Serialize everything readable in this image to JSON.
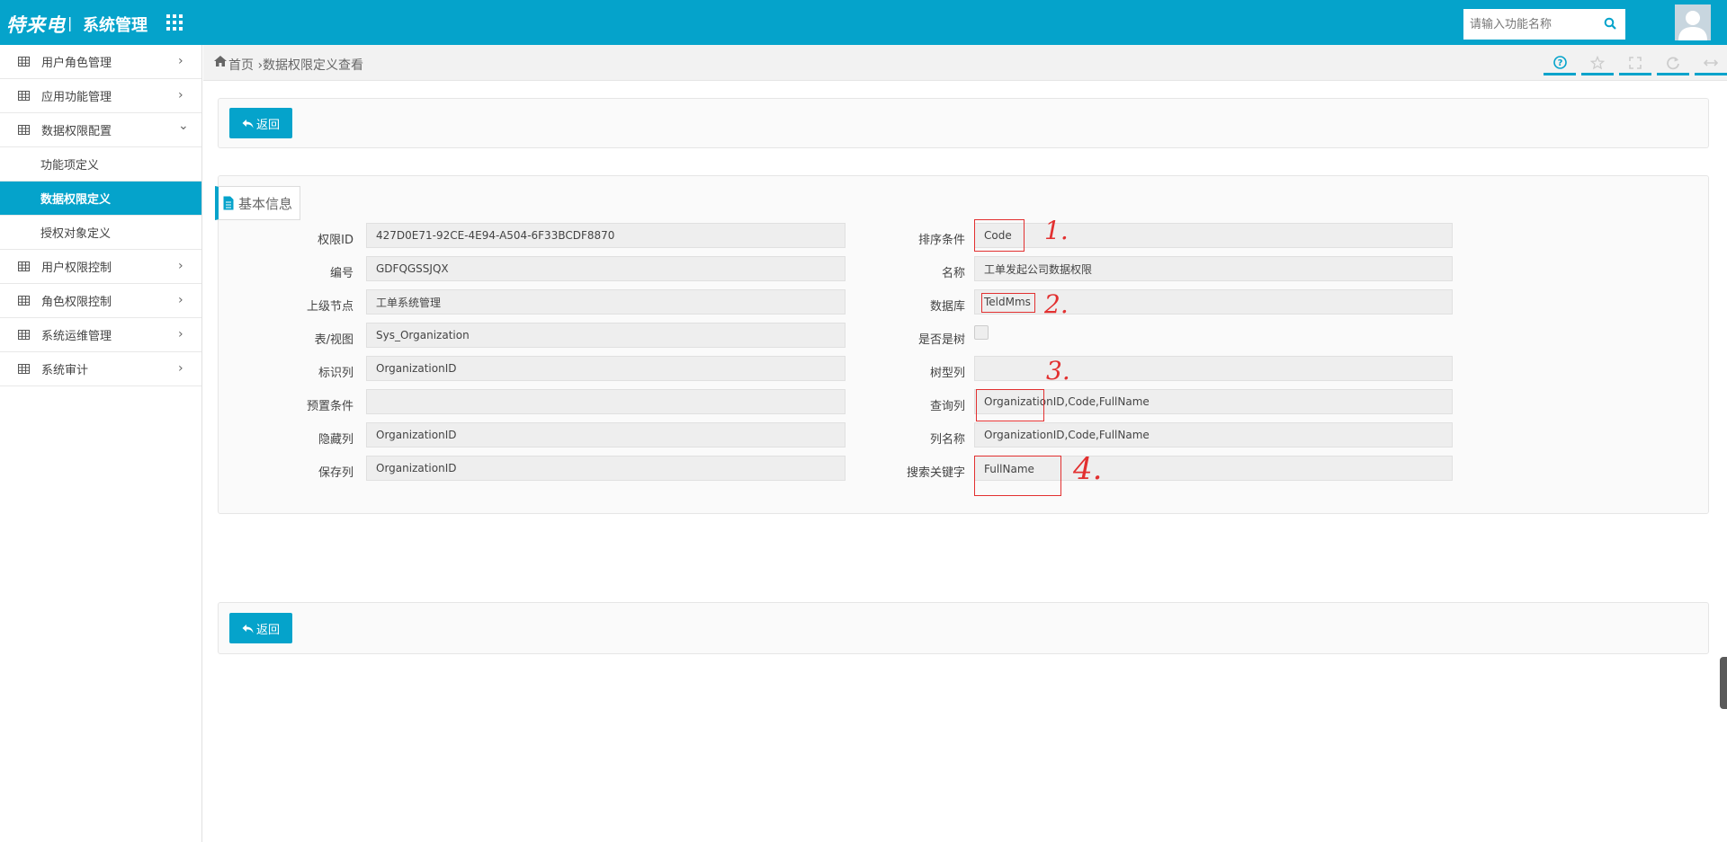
{
  "header": {
    "logo_text": "特来电",
    "separator": "|",
    "system_title": "系统管理",
    "search_placeholder": "请输入功能名称",
    "accent_color": "#05a3cb"
  },
  "sidebar": {
    "items": [
      {
        "label": "用户角色管理",
        "chevron": "›"
      },
      {
        "label": "应用功能管理",
        "chevron": "›"
      },
      {
        "label": "数据权限配置",
        "chevron": "⌄"
      },
      {
        "label": "用户权限控制",
        "chevron": "›"
      },
      {
        "label": "角色权限控制",
        "chevron": "›"
      },
      {
        "label": "系统运维管理",
        "chevron": "›"
      },
      {
        "label": "系统审计",
        "chevron": "›"
      }
    ],
    "subitems": [
      {
        "label": "功能项定义"
      },
      {
        "label": "数据权限定义",
        "active": true
      },
      {
        "label": "授权对象定义"
      }
    ]
  },
  "breadcrumb": {
    "text": "首页 ›数据权限定义查看"
  },
  "toolbar": {
    "icons": [
      "help-icon",
      "star-icon",
      "fullscreen-icon",
      "refresh-icon",
      "expand-icon"
    ]
  },
  "back_button_label": "返回",
  "info_tab_label": "基本信息",
  "form": {
    "left": [
      {
        "label": "权限ID",
        "value": "427D0E71-92CE-4E94-A504-6F33BCDF8870"
      },
      {
        "label": "编号",
        "value": "GDFQGSSJQX"
      },
      {
        "label": "上级节点",
        "value": "工单系统管理"
      },
      {
        "label": "表/视图",
        "value": "Sys_Organization"
      },
      {
        "label": "标识列",
        "value": "OrganizationID"
      },
      {
        "label": "预置条件",
        "value": ""
      },
      {
        "label": "隐藏列",
        "value": "OrganizationID"
      },
      {
        "label": "保存列",
        "value": "OrganizationID"
      }
    ],
    "right": [
      {
        "label": "排序条件",
        "value": "Code"
      },
      {
        "label": "名称",
        "value": "工单发起公司数据权限"
      },
      {
        "label": "数据库",
        "value": "TeldMms"
      },
      {
        "label": "是否是树",
        "value": "",
        "checked": false
      },
      {
        "label": "树型列",
        "value": ""
      },
      {
        "label": "查询列",
        "value": "OrganizationID,Code,FullName"
      },
      {
        "label": "列名称",
        "value": "OrganizationID,Code,FullName"
      },
      {
        "label": "搜索关键字",
        "value": "FullName"
      }
    ]
  },
  "annotations": {
    "numbers": [
      "1.",
      "2.",
      "3.",
      "4."
    ],
    "color": "#e23030"
  }
}
